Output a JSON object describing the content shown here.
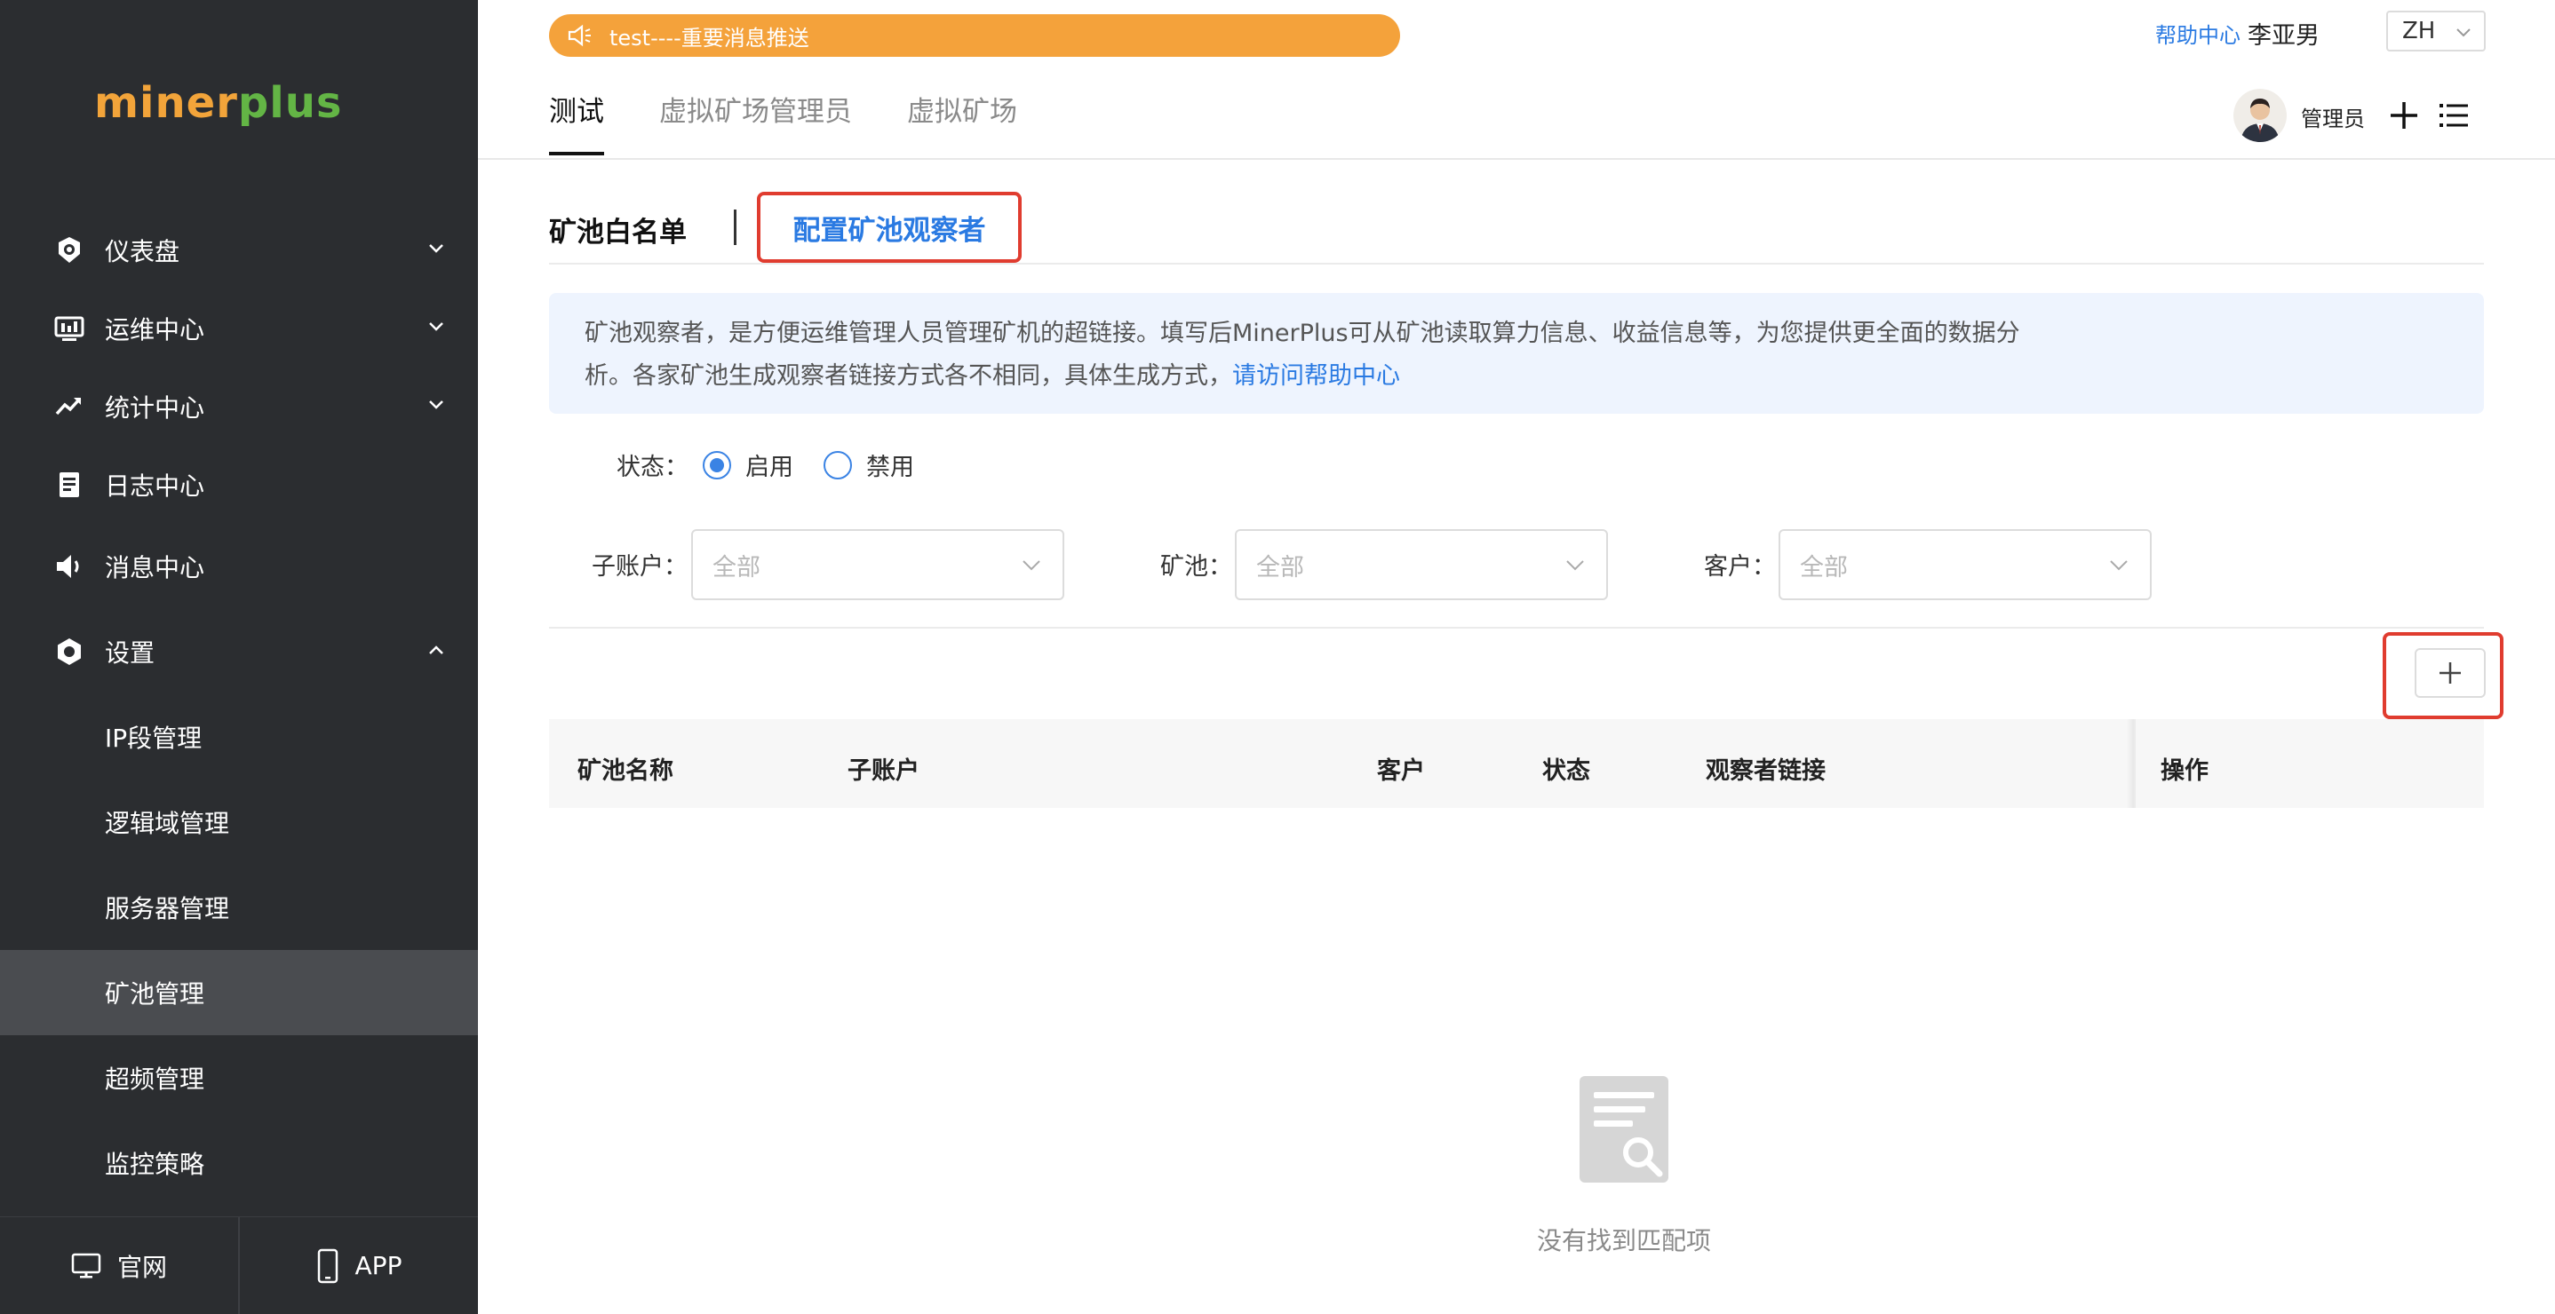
{
  "brand": {
    "logo_part1": "miner",
    "logo_part2": "plus"
  },
  "sidebar": {
    "items": [
      {
        "label": "仪表盘",
        "icon": "dashboard-icon"
      },
      {
        "label": "运维中心",
        "icon": "monitor-icon"
      },
      {
        "label": "统计中心",
        "icon": "trend-icon"
      },
      {
        "label": "日志中心",
        "icon": "log-icon"
      },
      {
        "label": "消息中心",
        "icon": "speaker-icon"
      },
      {
        "label": "设置",
        "icon": "settings-icon"
      }
    ],
    "sub_items": [
      {
        "label": "IP段管理"
      },
      {
        "label": "逻辑域管理"
      },
      {
        "label": "服务器管理"
      },
      {
        "label": "矿池管理",
        "active": true
      },
      {
        "label": "超频管理"
      },
      {
        "label": "监控策略"
      }
    ],
    "bottom": {
      "website": "官网",
      "app": "APP"
    }
  },
  "header": {
    "notice": "test----重要消息推送",
    "help": "帮助中心",
    "user": "李亚男",
    "lang": "ZH",
    "tabs": [
      "测试",
      "虚拟矿场管理员",
      "虚拟矿场"
    ],
    "role": "管理员"
  },
  "page": {
    "subtab_whitelist": "矿池白名单",
    "subtab_observer": "配置矿池观察者",
    "info_line1": "矿池观察者，是方便运维管理人员管理矿机的超链接。填写后MinerPlus可从矿池读取算力信息、收益信息等，为您提供更全面的数据分",
    "info_line2": "析。各家矿池生成观察者链接方式各不相同，具体生成方式，",
    "info_link": "请访问帮助中心",
    "status_label": "状态：",
    "status_enabled": "启用",
    "status_disabled": "禁用",
    "filters": {
      "subaccount_label": "子账户：",
      "pool_label": "矿池：",
      "customer_label": "客户：",
      "subaccount_value": "全部",
      "pool_value": "全部",
      "customer_value": "全部"
    },
    "table": {
      "headers": [
        "矿池名称",
        "子账户",
        "客户",
        "状态",
        "观察者链接",
        "操作"
      ]
    },
    "empty_text": "没有找到匹配项"
  },
  "colors": {
    "sidebar_bg": "#2b2d30",
    "accent_blue": "#2a7ae2",
    "notice_orange": "#f4a23b",
    "highlight_red": "#e03c2f",
    "logo_orange": "#f2a43a",
    "logo_green": "#63b545"
  }
}
